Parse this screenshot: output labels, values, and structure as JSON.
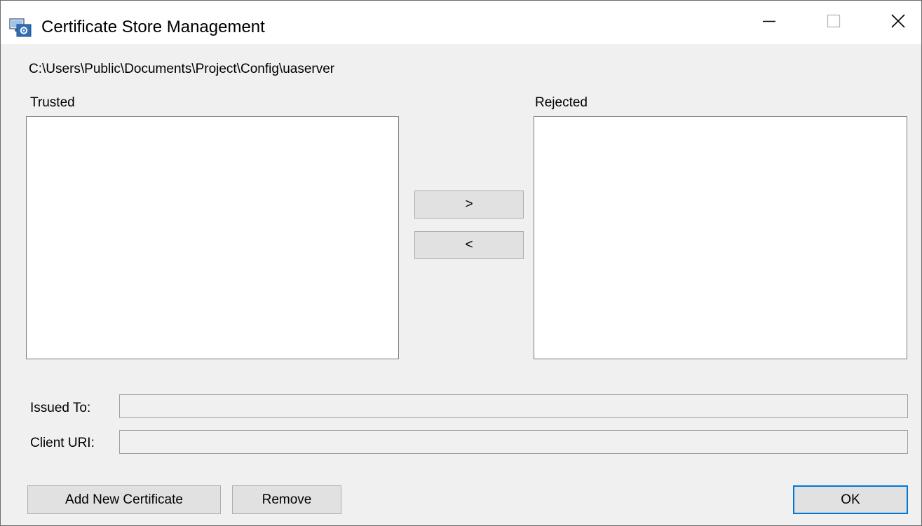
{
  "window": {
    "title": "Certificate Store Management",
    "icon": "certificate-store-app-icon"
  },
  "title_buttons": {
    "minimize": "minimize-icon",
    "maximize": "maximize-icon",
    "close": "close-icon"
  },
  "store_path": "C:\\Users\\Public\\Documents\\Project\\Config\\uaserver",
  "trusted": {
    "label": "Trusted",
    "items": []
  },
  "rejected": {
    "label": "Rejected",
    "items": []
  },
  "move_buttons": {
    "to_rejected": ">",
    "to_trusted": "<"
  },
  "details": {
    "issued_to_label": "Issued To:",
    "issued_to_value": "",
    "client_uri_label": "Client URI:",
    "client_uri_value": ""
  },
  "actions": {
    "add_label": "Add New Certificate",
    "remove_label": "Remove",
    "ok_label": "OK"
  },
  "colors": {
    "dialog_background": "#f0f0f0",
    "titlebar_background": "#ffffff",
    "button_face": "#e1e1e1",
    "default_button_border": "#0078d7"
  }
}
